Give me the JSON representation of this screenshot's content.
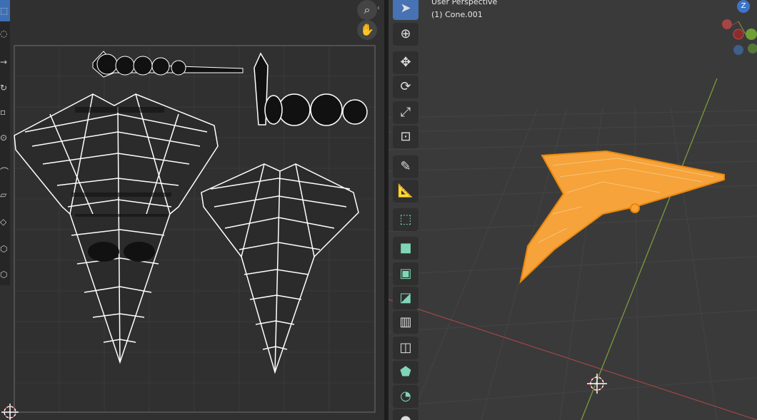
{
  "viewport": {
    "mode_label": "User Perspective",
    "object_label": "(1) Cone.001",
    "gizmo_z_label": "Z"
  },
  "uv_editor": {
    "zoom_icon": "zoom-in-icon",
    "pan_icon": "hand-icon",
    "collapse_icon": "chevron-left-icon"
  },
  "colors": {
    "mesh_orange": "#f5a33a",
    "selection_outline": "#e8860b",
    "active_tool": "#4772b3",
    "grid_line": "#454545",
    "axis_green": "#7fa23a",
    "axis_red": "#a24646"
  }
}
